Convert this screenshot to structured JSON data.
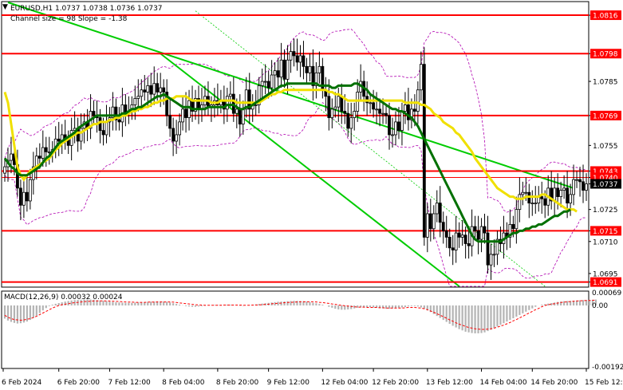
{
  "header": {
    "symbol_line": "EURUSD,H1  1.0737 1.0738 1.0736 1.0737",
    "channel_line": "Channel size = 98 Slope = -1.38"
  },
  "macd": {
    "label": "MACD(12,26,9) 0.00032 0.00024",
    "axis_labels": [
      "0.00069",
      "0.00",
      "-0.00192"
    ]
  },
  "colors": {
    "candle": "#000000",
    "level_line": "#ff0000",
    "channel": "#00cc00",
    "ma_fast": "#f0e000",
    "ma_slow": "#007000",
    "bollinger": "#b000b0",
    "macd_hist": "#b4b4b4",
    "macd_signal": "#ff0000",
    "price_badge_red": "#ff0000",
    "price_badge_current": "#000000"
  },
  "chart_data": {
    "type": "line",
    "title": "EURUSD,H1",
    "x_tick_labels": [
      "6 Feb 2024",
      "6 Feb 20:00",
      "7 Feb 12:00",
      "8 Feb 04:00",
      "8 Feb 20:00",
      "9 Feb 12:00",
      "12 Feb 04:00",
      "12 Feb 20:00",
      "13 Feb 12:00",
      "14 Feb 04:00",
      "14 Feb 20:00",
      "15 Feb 12:00"
    ],
    "y_tick_labels": [
      "1.0816",
      "1.0798",
      "1.0785",
      "1.0769",
      "1.0755",
      "1.0743",
      "1.0740",
      "1.0737",
      "1.0725",
      "1.0715",
      "1.0710",
      "1.0695",
      "1.0691"
    ],
    "ylim": [
      1.0689,
      1.0822
    ],
    "current_price": 1.0737,
    "horizontal_levels": [
      1.0816,
      1.0798,
      1.0769,
      1.0743,
      1.074,
      1.0715,
      1.0691
    ],
    "channel_lines": [
      {
        "name": "upper",
        "from": [
          1,
          1.0822
        ],
        "to": [
          179,
          1.0735
        ]
      },
      {
        "name": "lower",
        "from": [
          49,
          1.0798
        ],
        "to": [
          143,
          1.0689
        ]
      }
    ],
    "series": [
      {
        "kind": "close",
        "values": [
          1.0745,
          1.0748,
          1.0751,
          1.0746,
          1.0735,
          1.0727,
          1.0733,
          1.0729,
          1.0739,
          1.0745,
          1.075,
          1.0749,
          1.0754,
          1.0752,
          1.0752,
          1.0753,
          1.0758,
          1.0757,
          1.076,
          1.0758,
          1.0755,
          1.0762,
          1.0763,
          1.0757,
          1.0763,
          1.0766,
          1.0763,
          1.0771,
          1.0769,
          1.0768,
          1.0762,
          1.076,
          1.0766,
          1.0768,
          1.0773,
          1.0767,
          1.0766,
          1.0774,
          1.077,
          1.0771,
          1.0774,
          1.0777,
          1.0778,
          1.0781,
          1.078,
          1.0783,
          1.0779,
          1.0784,
          1.078,
          1.0782,
          1.078,
          1.0769,
          1.0763,
          1.0757,
          1.076,
          1.0766,
          1.0772,
          1.0768,
          1.0776,
          1.0771,
          1.0777,
          1.0772,
          1.0774,
          1.0778,
          1.0773,
          1.0774,
          1.0776,
          1.0774,
          1.0776,
          1.0772,
          1.0778,
          1.0779,
          1.077,
          1.0772,
          1.0765,
          1.0772,
          1.0781,
          1.0772,
          1.0774,
          1.0774,
          1.0783,
          1.0785,
          1.0785,
          1.0782,
          1.0788,
          1.079,
          1.0787,
          1.0795,
          1.0786,
          1.0795,
          1.0799,
          1.0797,
          1.0794,
          1.0797,
          1.0792,
          1.0789,
          1.0792,
          1.0783,
          1.0789,
          1.0792,
          1.0781,
          1.0778,
          1.0768,
          1.0772,
          1.0773,
          1.0778,
          1.0771,
          1.077,
          1.0763,
          1.0768,
          1.0771,
          1.078,
          1.0785,
          1.0778,
          1.0775,
          1.0775,
          1.0772,
          1.0772,
          1.077,
          1.077,
          1.0769,
          1.076,
          1.076,
          1.0766,
          1.0762,
          1.0771,
          1.0774,
          1.0767,
          1.0772,
          1.0771,
          1.0781,
          1.0793,
          1.0712,
          1.0723,
          1.0716,
          1.0723,
          1.0728,
          1.0719,
          1.0715,
          1.0712,
          1.0707,
          1.0706,
          1.0714,
          1.0712,
          1.0713,
          1.0709,
          1.0708,
          1.0717,
          1.0715,
          1.0711,
          1.0717,
          1.0714,
          1.0699,
          1.0704,
          1.0704,
          1.0711,
          1.0709,
          1.0714,
          1.0712,
          1.0718,
          1.0716,
          1.0725,
          1.0732,
          1.0733,
          1.0733,
          1.0728,
          1.0728,
          1.0728,
          1.0731,
          1.073,
          1.0727,
          1.0735,
          1.0729,
          1.0735,
          1.0731,
          1.0734,
          1.0735,
          1.0728,
          1.0732,
          1.0739,
          1.0739,
          1.0738,
          1.0734,
          1.0737
        ]
      },
      {
        "kind": "moving-average-fast",
        "values": [
          1.078,
          1.0775,
          1.0765,
          1.0755,
          1.0745,
          1.0741,
          1.0739,
          1.0741,
          1.0743,
          1.0744,
          1.0745,
          1.0746,
          1.0747,
          1.0748,
          1.0749,
          1.0751,
          1.0753,
          1.0754,
          1.0756,
          1.0757,
          1.0758,
          1.0759,
          1.076,
          1.0761,
          1.0761,
          1.0762,
          1.0763,
          1.0764,
          1.0765,
          1.0765,
          1.0766,
          1.0766,
          1.0766,
          1.0767,
          1.0767,
          1.0768,
          1.0768,
          1.0769,
          1.0769,
          1.077,
          1.0771,
          1.0771,
          1.0772,
          1.0772,
          1.0773,
          1.0773,
          1.0774,
          1.0775,
          1.0775,
          1.0776,
          1.0776,
          1.0777,
          1.0777,
          1.0777,
          1.0778,
          1.0778,
          1.0778,
          1.0778,
          1.0777,
          1.0776,
          1.0776,
          1.0776,
          1.0776,
          1.0776,
          1.0776,
          1.0775,
          1.0775,
          1.0775,
          1.0776,
          1.0776,
          1.0776,
          1.0776,
          1.0776,
          1.0775,
          1.0775,
          1.0775,
          1.0775,
          1.0775,
          1.0775,
          1.0775,
          1.0775,
          1.0776,
          1.0777,
          1.0778,
          1.0779,
          1.0779,
          1.078,
          1.078,
          1.0781,
          1.0781,
          1.0781,
          1.0781,
          1.0781,
          1.0781,
          1.0781,
          1.0781,
          1.0781,
          1.0781,
          1.0781,
          1.0781,
          1.0781,
          1.0781,
          1.078,
          1.078,
          1.0779,
          1.0779,
          1.0778,
          1.0777,
          1.0776,
          1.0776,
          1.0776,
          1.0776,
          1.0776,
          1.0776,
          1.0776,
          1.0776,
          1.0776,
          1.0776,
          1.0776,
          1.0776,
          1.0776,
          1.0776,
          1.0776,
          1.0776,
          1.0776,
          1.0776,
          1.0775,
          1.0775,
          1.0775,
          1.0775,
          1.0775,
          1.0774,
          1.0774,
          1.0773,
          1.0772,
          1.077,
          1.0769,
          1.0768,
          1.0766,
          1.0765,
          1.0764,
          1.0763,
          1.0761,
          1.076,
          1.0758,
          1.0756,
          1.0754,
          1.0752,
          1.0749,
          1.0747,
          1.0745,
          1.0743,
          1.0741,
          1.0739,
          1.0737,
          1.0735,
          1.0734,
          1.0733,
          1.0732,
          1.0731,
          1.0731,
          1.073,
          1.073,
          1.073,
          1.0731,
          1.0731,
          1.0731,
          1.0731,
          1.0731,
          1.0732,
          1.0732,
          1.0731,
          1.073,
          1.0729,
          1.0728,
          1.0727,
          1.0726,
          1.0725,
          1.0725,
          1.0725,
          1.0724
        ]
      },
      {
        "kind": "moving-average-slow",
        "values": [
          1.0749,
          1.0747,
          1.0745,
          1.0744,
          1.0742,
          1.0741,
          1.0741,
          1.0741,
          1.0742,
          1.0743,
          1.0744,
          1.0745,
          1.0747,
          1.0749,
          1.075,
          1.0752,
          1.0754,
          1.0756,
          1.0757,
          1.0758,
          1.0759,
          1.076,
          1.0761,
          1.0763,
          1.0764,
          1.0765,
          1.0766,
          1.0767,
          1.0768,
          1.0769,
          1.0769,
          1.0769,
          1.0769,
          1.0769,
          1.0769,
          1.0769,
          1.0769,
          1.077,
          1.077,
          1.0771,
          1.0772,
          1.0772,
          1.0773,
          1.0773,
          1.0774,
          1.0775,
          1.0776,
          1.0777,
          1.0778,
          1.0778,
          1.0779,
          1.0778,
          1.0777,
          1.0776,
          1.0775,
          1.0774,
          1.0773,
          1.0773,
          1.0773,
          1.0772,
          1.0772,
          1.0772,
          1.0772,
          1.0772,
          1.0773,
          1.0773,
          1.0773,
          1.0773,
          1.0773,
          1.0773,
          1.0774,
          1.0774,
          1.0774,
          1.0773,
          1.0772,
          1.0772,
          1.0773,
          1.0773,
          1.0774,
          1.0775,
          1.0776,
          1.0777,
          1.0778,
          1.0779,
          1.078,
          1.0781,
          1.0782,
          1.0783,
          1.0783,
          1.0784,
          1.0784,
          1.0784,
          1.0784,
          1.0784,
          1.0784,
          1.0784,
          1.0784,
          1.0784,
          1.0784,
          1.0783,
          1.0783,
          1.0783,
          1.0783,
          1.0782,
          1.0782,
          1.0783,
          1.0783,
          1.0783,
          1.0783,
          1.0783,
          1.0784,
          1.0784,
          1.0783,
          1.0782,
          1.0781,
          1.0779,
          1.0778,
          1.0777,
          1.0776,
          1.0775,
          1.0774,
          1.0773,
          1.0772,
          1.0772,
          1.0771,
          1.0771,
          1.077,
          1.0769,
          1.0768,
          1.0766,
          1.0764,
          1.0761,
          1.0758,
          1.0755,
          1.0752,
          1.0749,
          1.0746,
          1.0743,
          1.074,
          1.0737,
          1.0734,
          1.0731,
          1.0728,
          1.0725,
          1.0722,
          1.0719,
          1.0716,
          1.0713,
          1.0711,
          1.071,
          1.071,
          1.071,
          1.071,
          1.071,
          1.071,
          1.071,
          1.071,
          1.0711,
          1.0712,
          1.0713,
          1.0714,
          1.0714,
          1.0715,
          1.0715,
          1.0716,
          1.0716,
          1.0717,
          1.0717,
          1.0718,
          1.0718,
          1.0719,
          1.072,
          1.0721,
          1.0722,
          1.0722,
          1.0723,
          1.0724,
          1.0724,
          1.0725
        ]
      }
    ],
    "macd_hist": [
      -0.0004,
      -0.00046,
      -0.0005,
      -0.00053,
      -0.00055,
      -0.00054,
      -0.00052,
      -0.00049,
      -0.00044,
      -0.00038,
      -0.00031,
      -0.00023,
      -0.00015,
      -8e-05,
      -2e-05,
      4e-05,
      9e-05,
      0.00013,
      0.00017,
      0.00021,
      0.00024,
      0.00027,
      0.00029,
      0.0003,
      0.00031,
      0.00032,
      0.00032,
      0.00032,
      0.00031,
      0.00029,
      0.00027,
      0.00025,
      0.00023,
      0.00021,
      0.00019,
      0.00017,
      0.00016,
      0.00015,
      0.00014,
      0.00014,
      0.00014,
      0.00015,
      0.00016,
      0.00017,
      0.00018,
      0.00019,
      0.0002,
      0.00021,
      0.00022,
      0.00022,
      0.00021,
      0.00019,
      0.00016,
      0.00012,
      8e-05,
      4e-05,
      1e-05,
      -2e-05,
      -3e-05,
      -4e-05,
      -4e-05,
      -3e-05,
      -2e-05,
      -1e-05,
      0.0,
      1e-05,
      2e-05,
      3e-05,
      4e-05,
      4e-05,
      4e-05,
      3e-05,
      2e-05,
      0.0,
      -1e-05,
      -1e-05,
      0.0,
      2e-05,
      4e-05,
      6e-05,
      8e-05,
      0.0001,
      0.00012,
      0.00014,
      0.00016,
      0.00018,
      0.0002,
      0.00021,
      0.00022,
      0.00023,
      0.00024,
      0.00025,
      0.00025,
      0.00024,
      0.00023,
      0.00021,
      0.00018,
      0.00015,
      0.00012,
      8e-05,
      4e-05,
      0.0,
      -4e-05,
      -7e-05,
      -0.0001,
      -0.00012,
      -0.00013,
      -0.00013,
      -0.00012,
      -0.00011,
      -9e-05,
      -7e-05,
      -6e-05,
      -5e-05,
      -5e-05,
      -5e-05,
      -6e-05,
      -7e-05,
      -8e-05,
      -9e-05,
      -0.0001,
      -0.0001,
      -9e-05,
      -8e-05,
      -7e-05,
      -6e-05,
      -5e-05,
      -3e-05,
      -2e-05,
      -2e-05,
      -3e-05,
      -6e-05,
      -0.0001,
      -0.00015,
      -0.0002,
      -0.00026,
      -0.00032,
      -0.00038,
      -0.00044,
      -0.0005,
      -0.00056,
      -0.00062,
      -0.00067,
      -0.00072,
      -0.00076,
      -0.0008,
      -0.00082,
      -0.00084,
      -0.00085,
      -0.00085,
      -0.00084,
      -0.00082,
      -0.00078,
      -0.00074,
      -0.00069,
      -0.00064,
      -0.00059,
      -0.00054,
      -0.00049,
      -0.00044,
      -0.00039,
      -0.00034,
      -0.00029,
      -0.00024,
      -0.00019,
      -0.00014,
      -9e-05,
      -4e-05,
      0.0,
      4e-05,
      7e-05,
      0.0001,
      0.00013,
      0.00016,
      0.00019,
      0.00021,
      0.00023,
      0.00024,
      0.00025,
      0.00026,
      0.00027,
      0.00028,
      0.00029,
      0.0003,
      0.0003,
      0.00031,
      0.00032
    ],
    "macd_signal": [
      -0.0003,
      -0.00036,
      -0.0004,
      -0.00043,
      -0.00044,
      -0.00045,
      -0.00044,
      -0.00042,
      -0.0004,
      -0.00037,
      -0.00033,
      -0.00028,
      -0.00023,
      -0.00018,
      -0.00013,
      -8e-05,
      -4e-05,
      0.0,
      4e-05,
      7e-05,
      0.0001,
      0.00013,
      0.00015,
      0.00017,
      0.00019,
      0.00021,
      0.00022,
      0.00023,
      0.00024,
      0.00024,
      0.00025,
      0.00025,
      0.00024,
      0.00024,
      0.00023,
      0.00022,
      0.00021,
      0.0002,
      0.00019,
      0.00018,
      0.00018,
      0.00017,
      0.00017,
      0.00017,
      0.00017,
      0.00018,
      0.00018,
      0.00018,
      0.00019,
      0.00019,
      0.00019,
      0.00019,
      0.00019,
      0.00018,
      0.00016,
      0.00014,
      0.00012,
      0.0001,
      8e-05,
      6e-05,
      4e-05,
      3e-05,
      2e-05,
      1e-05,
      1e-05,
      1e-05,
      1e-05,
      1e-05,
      1e-05,
      2e-05,
      2e-05,
      2e-05,
      2e-05,
      2e-05,
      2e-05,
      1e-05,
      1e-05,
      1e-05,
      2e-05,
      2e-05,
      3e-05,
      4e-05,
      6e-05,
      7e-05,
      9e-05,
      0.0001,
      0.00012,
      0.00013,
      0.00015,
      0.00016,
      0.00017,
      0.00018,
      0.00019,
      0.0002,
      0.0002,
      0.0002,
      0.0002,
      0.0002,
      0.00019,
      0.00017,
      0.00016,
      0.00013,
      0.00011,
      8e-05,
      6e-05,
      3e-05,
      1e-05,
      -1e-05,
      -2e-05,
      -3e-05,
      -4e-05,
      -5e-05,
      -5e-05,
      -5e-05,
      -6e-05,
      -6e-05,
      -6e-05,
      -6e-05,
      -7e-05,
      -7e-05,
      -8e-05,
      -8e-05,
      -8e-05,
      -8e-05,
      -8e-05,
      -8e-05,
      -7e-05,
      -6e-05,
      -6e-05,
      -6e-05,
      -7e-05,
      -8e-05,
      -0.0001,
      -0.00013,
      -0.00017,
      -0.00021,
      -0.00025,
      -0.0003,
      -0.00034,
      -0.00039,
      -0.00044,
      -0.00048,
      -0.00053,
      -0.00057,
      -0.0006,
      -0.00064,
      -0.00067,
      -0.00069,
      -0.00071,
      -0.00072,
      -0.00073,
      -0.00073,
      -0.00072,
      -0.00071,
      -0.00069,
      -0.00066,
      -0.00063,
      -0.0006,
      -0.00056,
      -0.00052,
      -0.00047,
      -0.00043,
      -0.00038,
      -0.00033,
      -0.00028,
      -0.00023,
      -0.00018,
      -0.00013,
      -9e-05,
      -4e-05,
      0.0,
      4e-05,
      7e-05,
      0.0001,
      0.00013,
      0.00016,
      0.00018,
      0.0002,
      0.00021,
      0.00023,
      0.00024,
      0.00025,
      0.00026,
      0.00027,
      0.00027,
      0.00028,
      0.00029
    ]
  }
}
